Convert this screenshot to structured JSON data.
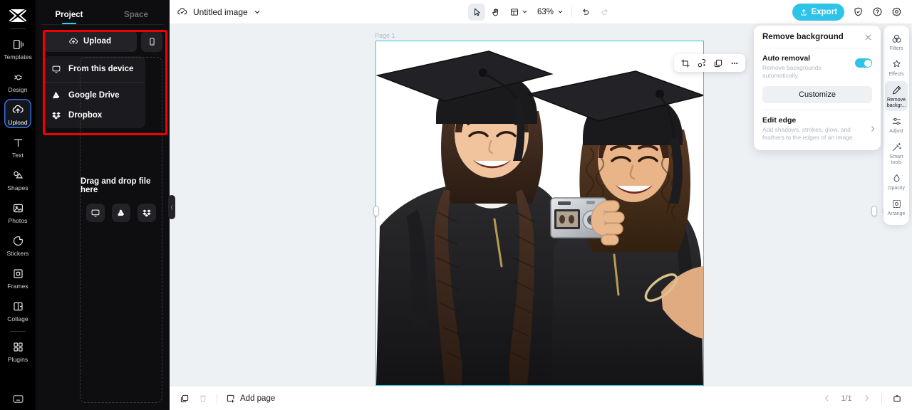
{
  "app": {
    "logo_icon": "capcut-logo-icon"
  },
  "left_rail": {
    "items": [
      {
        "label": "Templates",
        "icon": "templates-icon",
        "active": false
      },
      {
        "label": "Design",
        "icon": "design-icon",
        "active": false
      },
      {
        "label": "Upload",
        "icon": "upload-cloud-icon",
        "active": true
      },
      {
        "label": "Text",
        "icon": "text-icon",
        "active": false
      },
      {
        "label": "Shapes",
        "icon": "shapes-icon",
        "active": false
      },
      {
        "label": "Photos",
        "icon": "photos-icon",
        "active": false
      },
      {
        "label": "Stickers",
        "icon": "stickers-icon",
        "active": false
      },
      {
        "label": "Frames",
        "icon": "frames-icon",
        "active": false
      },
      {
        "label": "Collage",
        "icon": "collage-icon",
        "active": false
      },
      {
        "label": "Plugins",
        "icon": "plugins-icon",
        "active": false
      }
    ],
    "bottom_icon": "keyboard-shortcuts-icon"
  },
  "panel": {
    "tabs": [
      {
        "label": "Project",
        "active": true
      },
      {
        "label": "Space",
        "active": false
      }
    ],
    "upload_button": {
      "label": "Upload",
      "icon": "upload-cloud-icon"
    },
    "mobile_button_icon": "mobile-phone-icon",
    "menu": [
      {
        "label": "From this device",
        "icon": "monitor-icon"
      },
      {
        "label": "Google Drive",
        "icon": "google-drive-icon"
      },
      {
        "label": "Dropbox",
        "icon": "dropbox-icon"
      }
    ],
    "dropzone": {
      "text": "Drag and drop file here",
      "icons": [
        "monitor-icon",
        "google-drive-icon",
        "dropbox-icon"
      ]
    },
    "highlight_color": "#f00000"
  },
  "topbar": {
    "doc_icon": "cloud-saved-icon",
    "doc_name": "Untitled image",
    "doc_chevron_icon": "chevron-down-icon",
    "tools": [
      {
        "name": "select-tool",
        "icon": "cursor-arrow-icon",
        "selected": true
      },
      {
        "name": "hand-tool",
        "icon": "hand-icon",
        "selected": false
      },
      {
        "name": "layout-tool",
        "icon": "layout-icon",
        "selected": false
      }
    ],
    "zoom_level": "63%",
    "zoom_chevron_icon": "chevron-down-icon",
    "undo_icon": "undo-icon",
    "redo_icon": "redo-icon",
    "export": {
      "label": "Export",
      "icon": "export-icon",
      "color": "#2ec4e8"
    },
    "right_icons": [
      "shield-icon",
      "help-icon",
      "settings-gear-icon"
    ]
  },
  "canvas": {
    "page_label": "Page 1",
    "selection_color": "#2ec4e8",
    "float_toolbar": [
      {
        "name": "crop-button",
        "icon": "crop-icon"
      },
      {
        "name": "cutout-button",
        "icon": "magic-cutout-icon"
      },
      {
        "name": "duplicate-button",
        "icon": "duplicate-icon"
      },
      {
        "name": "more-button",
        "icon": "more-horizontal-icon"
      }
    ],
    "rotate_icon": "rotate-icon",
    "image_alt": "Two graduates in caps and gowns smiling while taking a photo with a compact camera, background removed"
  },
  "remove_bg_panel": {
    "title": "Remove background",
    "close_icon": "close-icon",
    "auto_removal": {
      "label": "Auto removal",
      "description": "Remove backgrounds automatically.",
      "enabled": true,
      "toggle_color": "#2ec4e8"
    },
    "customize_button": "Customize",
    "edit_edge": {
      "label": "Edit edge",
      "description": "Add shadows, strokes, glow, and feathers to the edges of an image.",
      "chevron_icon": "chevron-right-icon"
    }
  },
  "right_rail": {
    "items": [
      {
        "label": "Filters",
        "icon": "filters-icon",
        "active": false
      },
      {
        "label": "Effects",
        "icon": "effects-icon",
        "active": false
      },
      {
        "label": "Remove backgr...",
        "icon": "remove-bg-icon",
        "active": true
      },
      {
        "label": "Adjust",
        "icon": "adjust-icon",
        "active": false
      },
      {
        "label": "Smart tools",
        "icon": "smart-tools-icon",
        "active": false
      },
      {
        "label": "Opacity",
        "icon": "opacity-icon",
        "active": false
      },
      {
        "label": "Arrange",
        "icon": "arrange-icon",
        "active": false
      }
    ]
  },
  "bottombar": {
    "duplicate_icon": "duplicate-page-icon",
    "delete_icon": "trash-icon",
    "add_page": {
      "label": "Add page",
      "icon": "add-page-icon"
    },
    "prev_icon": "chevron-left-icon",
    "page_indicator": "1/1",
    "next_icon": "chevron-right-icon",
    "pages_icon": "pages-panel-icon"
  }
}
